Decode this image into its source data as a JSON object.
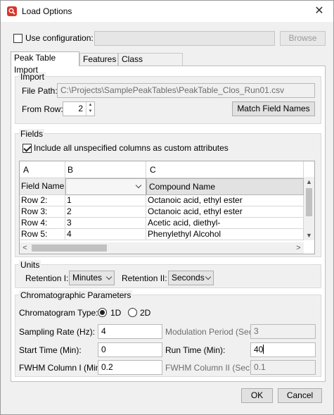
{
  "window": {
    "title": "Load Options",
    "close_label": "✕"
  },
  "config": {
    "label": "Use configuration:",
    "checked": false,
    "path": "",
    "browse_label": "Browse"
  },
  "tabs": [
    {
      "label": "Peak Table Import"
    },
    {
      "label": "Features"
    },
    {
      "label": "Class Assignment"
    }
  ],
  "import": {
    "heading": "Import",
    "file_path_label": "File Path:",
    "file_path": "C:\\Projects\\SamplePeakTables\\PeakTable_Clos_Run01.csv",
    "from_row_label": "From Row:",
    "from_row": "2",
    "match_button": "Match Field Names"
  },
  "fields": {
    "heading": "Fields",
    "include_label": "Include all unspecified columns as custom attributes",
    "include_checked": true,
    "columns": [
      "A",
      "B",
      "C"
    ],
    "field_names_label": "Field Names:",
    "field_b_value": "",
    "field_c_value": "Compound Name",
    "rows": [
      {
        "label": "Row 2:",
        "b": "1",
        "c": "Octanoic acid, ethyl ester"
      },
      {
        "label": "Row 3:",
        "b": "2",
        "c": "Octanoic acid, ethyl ester"
      },
      {
        "label": "Row 4:",
        "b": "3",
        "c": "Acetic acid, diethyl-"
      },
      {
        "label": "Row 5:",
        "b": "4",
        "c": "Phenylethyl Alcohol"
      }
    ]
  },
  "units": {
    "heading": "Units",
    "ret1_label": "Retention I:",
    "ret1_value": "Minutes",
    "ret2_label": "Retention II:",
    "ret2_value": "Seconds"
  },
  "chrom": {
    "heading": "Chromatographic Parameters",
    "type_label": "Chromatogram Type:",
    "opt_1d": "1D",
    "opt_2d": "2D",
    "selected": "1D",
    "sampling_label": "Sampling Rate (Hz):",
    "sampling_value": "4",
    "modulation_label": "Modulation Period (Sec):",
    "modulation_value": "3",
    "start_label": "Start Time (Min):",
    "start_value": "0",
    "run_label": "Run Time (Min):",
    "run_value": "40",
    "fwhm1_label": "FWHM Column I (Min):",
    "fwhm1_value": "0.2",
    "fwhm2_label": "FWHM Column II (Sec):",
    "fwhm2_value": "0.1"
  },
  "footer": {
    "ok_label": "OK",
    "cancel_label": "Cancel"
  }
}
